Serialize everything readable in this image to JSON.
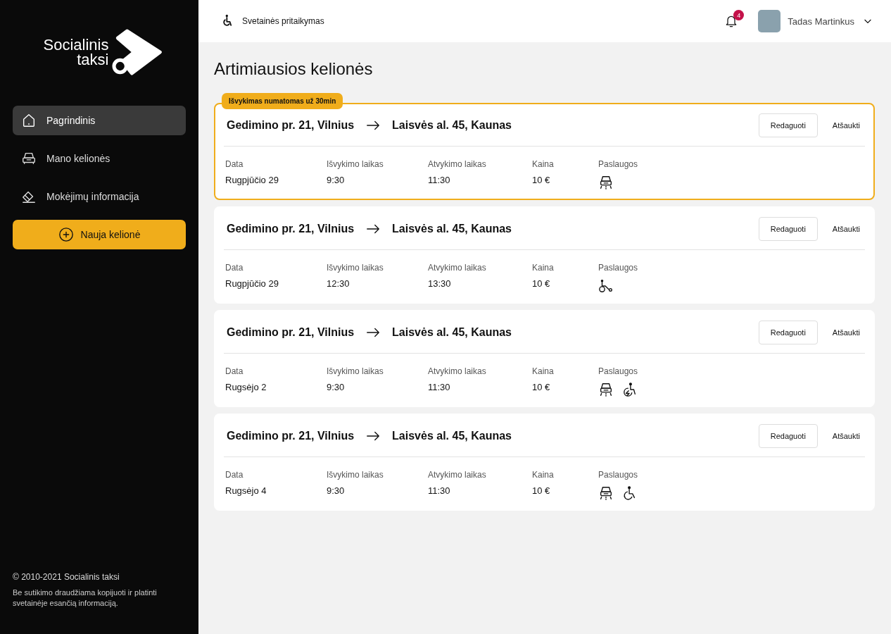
{
  "sidebar": {
    "logo": {
      "line1": "Socialinis",
      "line2": "taksi"
    },
    "items": [
      {
        "label": "Pagrindinis",
        "selected": true
      },
      {
        "label": "Mano kelionės",
        "selected": false
      },
      {
        "label": "Mokėjimų informacija",
        "selected": false
      }
    ],
    "new_trip_button": "Nauja kelionė",
    "footer": {
      "copyright": "© 2010-2021 Socialinis taksi",
      "notice": "Be sutikimo draudžiama kopijuoti ir platinti svetainėje esančią informaciją."
    }
  },
  "topbar": {
    "accessibility": "Svetainės pritaikymas",
    "notifications": "4",
    "user": "Tadas Martinkus"
  },
  "page_title": "Artimiausios kelionės",
  "trips": [
    {
      "badge": "Išvykimas numatomas už 30min",
      "highlighted": true,
      "from": "Gedimino pr. 21, Vilnius",
      "to": "Laisvės al. 45, Kaunas",
      "fields": [
        {
          "label": "Data",
          "value": "Rugpjūčio 29"
        },
        {
          "label": "Išvykimo laikas",
          "value": "9:30"
        },
        {
          "label": "Atvykimo laikas",
          "value": "11:30"
        },
        {
          "label": "Kaina",
          "value": "10 €"
        }
      ],
      "services_label": "Paslaugos",
      "services": [
        {
          "kind": "car"
        }
      ],
      "buttons": [
        "Redaguoti",
        "Atšaukti"
      ]
    },
    {
      "highlighted": false,
      "from": "Gedimino pr. 21, Vilnius",
      "to": "Laisvės al. 45, Kaunas",
      "fields": [
        {
          "label": "Data",
          "value": "Rugpjūčio 29"
        },
        {
          "label": "Išvykimo laikas",
          "value": "12:30"
        },
        {
          "label": "Atvykimo laikas",
          "value": "13:30"
        },
        {
          "label": "Kaina",
          "value": "10 €"
        }
      ],
      "services_label": "Paslaugos",
      "services": [
        {
          "kind": "scooter"
        }
      ],
      "buttons": [
        "Redaguoti",
        "Atšaukti"
      ]
    },
    {
      "highlighted": false,
      "from": "Gedimino pr. 21, Vilnius",
      "to": "Laisvės al. 45, Kaunas",
      "fields": [
        {
          "label": "Data",
          "value": "Rugsėjo 2"
        },
        {
          "label": "Išvykimo laikas",
          "value": "9:30"
        },
        {
          "label": "Atvykimo laikas",
          "value": "11:30"
        },
        {
          "label": "Kaina",
          "value": "10 €"
        }
      ],
      "services_label": "Paslaugos",
      "services": [
        {
          "kind": "car"
        },
        {
          "kind": "power-wheelchair"
        }
      ],
      "buttons": [
        "Redaguoti",
        "Atšaukti"
      ]
    },
    {
      "highlighted": false,
      "from": "Gedimino pr. 21, Vilnius",
      "to": "Laisvės al. 45, Kaunas",
      "fields": [
        {
          "label": "Data",
          "value": "Rugsėjo 4"
        },
        {
          "label": "Išvykimo laikas",
          "value": "9:30"
        },
        {
          "label": "Atvykimo laikas",
          "value": "11:30"
        },
        {
          "label": "Kaina",
          "value": "10 €"
        }
      ],
      "services_label": "Paslaugos",
      "services": [
        {
          "kind": "car"
        },
        {
          "kind": "wheelchair"
        }
      ],
      "buttons": [
        "Redaguoti",
        "Atšaukti"
      ]
    }
  ]
}
